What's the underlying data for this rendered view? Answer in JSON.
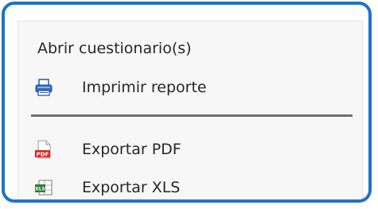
{
  "menu": {
    "items": [
      {
        "label": "Abrir cuestionario(s)",
        "icon": null
      },
      {
        "label": "Imprimir reporte",
        "icon": "printer-icon"
      },
      {
        "label": "Exportar PDF",
        "icon": "pdf-file-icon",
        "icon_text": "PDF"
      },
      {
        "label": "Exportar XLS",
        "icon": "xls-file-icon",
        "icon_text": "XLS"
      }
    ]
  },
  "colors": {
    "frame_border": "#1f73c8",
    "menu_background": "#f7f7f7",
    "divider": "#6e6e6e",
    "text": "#262626"
  }
}
